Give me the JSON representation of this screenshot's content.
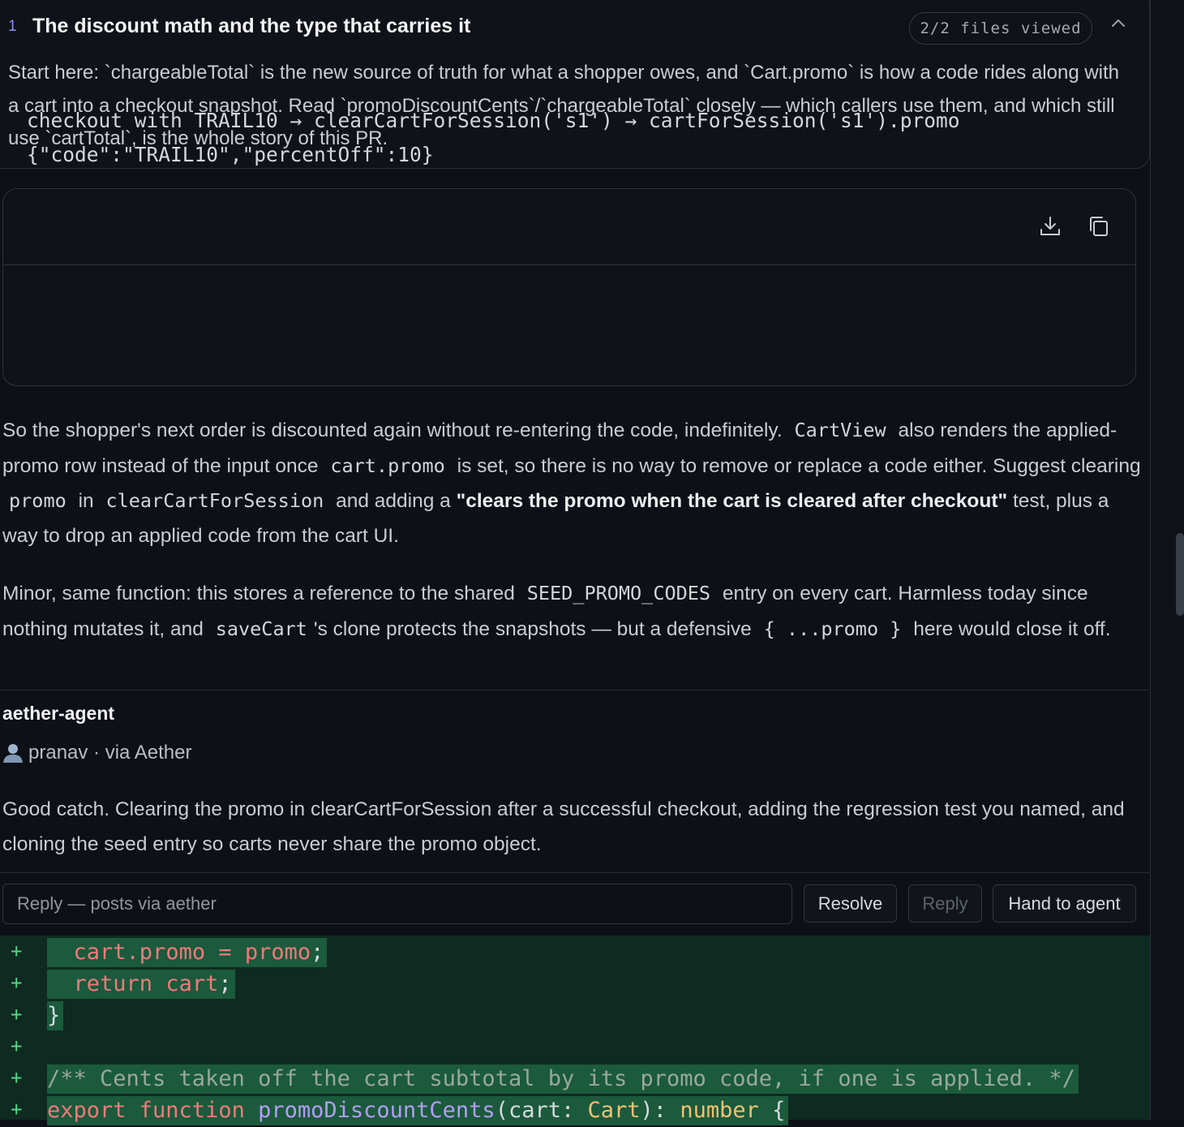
{
  "section": {
    "number": "1",
    "title": "The discount math and the type that carries it",
    "files_viewed": "2/2 files viewed",
    "description": "Start here: `chargeableTotal` is the new source of truth for what a shopper owes, and `Cart.promo` is how a code rides along with a cart into a checkout snapshot. Read `promoDiscountCents`/`chargeableTotal` closely — which callers use them, and which still use `cartTotal`, is the whole story of this PR."
  },
  "code_block": {
    "line1": "checkout with TRAIL10 → clearCartForSession('s1') → cartForSession('s1').promo",
    "line2": "{\"code\":\"TRAIL10\",\"percentOff\":10}"
  },
  "comment": {
    "p1_a": "So the shopper's next order is discounted again without re-entering the code, indefinitely.",
    "p1_code1": "CartView",
    "p1_b": "also renders the applied-promo row instead of the input once",
    "p1_code2": "cart.promo",
    "p1_c": "is set, so there is no way to remove or replace a code either. Suggest clearing",
    "p1_code3": "promo",
    "p1_d": "in",
    "p1_code4": "clearCartForSession",
    "p1_e": "and adding a",
    "p1_bold": "\"clears the promo when the cart is cleared after checkout\"",
    "p1_f": "test, plus a way to drop an applied code from the cart UI.",
    "p2_a": "Minor, same function: this stores a reference to the shared",
    "p2_code1": "SEED_PROMO_CODES",
    "p2_b": "entry on every cart. Harmless today since nothing mutates it, and",
    "p2_code2": "saveCart",
    "p2_c": "'s clone protects the snapshots — but a defensive",
    "p2_code3": "{ ...promo }",
    "p2_d": "here would close it off."
  },
  "reply": {
    "author": "aether-agent",
    "meta": "pranav · via Aether",
    "text": "Good catch. Clearing the promo in clearCartForSession after a successful checkout, adding the regression test you named, and cloning the seed entry so carts never share the promo object."
  },
  "reply_bar": {
    "placeholder": "Reply — posts via aether",
    "resolve": "Resolve",
    "reply": "Reply",
    "hand_to_agent": "Hand to agent"
  },
  "diff": {
    "marker": "+",
    "l1_a": "  cart",
    "l1_b": ".promo = promo",
    "l1_c": ";",
    "l2_a": "  return ",
    "l2_b": "cart",
    "l2_c": ";",
    "l3": "}",
    "l5": "/** Cents taken off the cart subtotal by its promo code, if one is applied. */",
    "l6_kw": "export function ",
    "l6_fn": "promoDiscountCents",
    "l6_a": "(cart: ",
    "l6_ty": "Cart",
    "l6_b": "): ",
    "l6_ty2": "number",
    "l6_c": " {"
  },
  "colors": {
    "background": "#0d1016",
    "accent_number": "#8f8cf0",
    "diff_bg": "#0f2a20",
    "diff_highlight": "#1b5a3c",
    "diff_plus": "#56d08a"
  },
  "icons": [
    "chevron-up-icon",
    "download-icon",
    "copy-icon",
    "user-icon"
  ]
}
